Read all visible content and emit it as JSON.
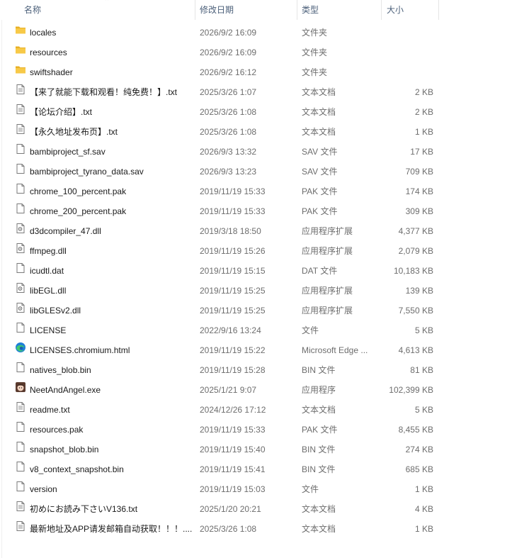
{
  "columns": {
    "name": "名称",
    "date": "修改日期",
    "type": "类型",
    "size": "大小"
  },
  "sort_indicator": "⌃",
  "files": [
    {
      "name": "locales",
      "date": "2026/9/2 16:09",
      "type": "文件夹",
      "size": "",
      "icon": "folder-icon"
    },
    {
      "name": "resources",
      "date": "2026/9/2 16:09",
      "type": "文件夹",
      "size": "",
      "icon": "folder-icon"
    },
    {
      "name": "swiftshader",
      "date": "2026/9/2 16:12",
      "type": "文件夹",
      "size": "",
      "icon": "folder-icon"
    },
    {
      "name": "【来了就能下载和观看！纯免费！】.txt",
      "date": "2025/3/26 1:07",
      "type": "文本文档",
      "size": "2 KB",
      "icon": "text-file-icon"
    },
    {
      "name": "【论坛介绍】.txt",
      "date": "2025/3/26 1:08",
      "type": "文本文档",
      "size": "2 KB",
      "icon": "text-file-icon"
    },
    {
      "name": "【永久地址发布页】.txt",
      "date": "2025/3/26 1:08",
      "type": "文本文档",
      "size": "1 KB",
      "icon": "text-file-icon"
    },
    {
      "name": "bambiproject_sf.sav",
      "date": "2026/9/3 13:32",
      "type": "SAV 文件",
      "size": "17 KB",
      "icon": "file-icon"
    },
    {
      "name": "bambiproject_tyrano_data.sav",
      "date": "2026/9/3 13:23",
      "type": "SAV 文件",
      "size": "709 KB",
      "icon": "file-icon"
    },
    {
      "name": "chrome_100_percent.pak",
      "date": "2019/11/19 15:33",
      "type": "PAK 文件",
      "size": "174 KB",
      "icon": "file-icon"
    },
    {
      "name": "chrome_200_percent.pak",
      "date": "2019/11/19 15:33",
      "type": "PAK 文件",
      "size": "309 KB",
      "icon": "file-icon"
    },
    {
      "name": "d3dcompiler_47.dll",
      "date": "2019/3/18 18:50",
      "type": "应用程序扩展",
      "size": "4,377 KB",
      "icon": "dll-file-icon"
    },
    {
      "name": "ffmpeg.dll",
      "date": "2019/11/19 15:26",
      "type": "应用程序扩展",
      "size": "2,079 KB",
      "icon": "dll-file-icon"
    },
    {
      "name": "icudtl.dat",
      "date": "2019/11/19 15:15",
      "type": "DAT 文件",
      "size": "10,183 KB",
      "icon": "file-icon"
    },
    {
      "name": "libEGL.dll",
      "date": "2019/11/19 15:25",
      "type": "应用程序扩展",
      "size": "139 KB",
      "icon": "dll-file-icon"
    },
    {
      "name": "libGLESv2.dll",
      "date": "2019/11/19 15:25",
      "type": "应用程序扩展",
      "size": "7,550 KB",
      "icon": "dll-file-icon"
    },
    {
      "name": "LICENSE",
      "date": "2022/9/16 13:24",
      "type": "文件",
      "size": "5 KB",
      "icon": "file-icon"
    },
    {
      "name": "LICENSES.chromium.html",
      "date": "2019/11/19 15:22",
      "type": "Microsoft Edge ...",
      "size": "4,613 KB",
      "icon": "edge-icon"
    },
    {
      "name": "natives_blob.bin",
      "date": "2019/11/19 15:28",
      "type": "BIN 文件",
      "size": "81 KB",
      "icon": "file-icon"
    },
    {
      "name": "NeetAndAngel.exe",
      "date": "2025/1/21 9:07",
      "type": "应用程序",
      "size": "102,399 KB",
      "icon": "app-character-icon"
    },
    {
      "name": "readme.txt",
      "date": "2024/12/26 17:12",
      "type": "文本文档",
      "size": "5 KB",
      "icon": "text-file-icon"
    },
    {
      "name": "resources.pak",
      "date": "2019/11/19 15:33",
      "type": "PAK 文件",
      "size": "8,455 KB",
      "icon": "file-icon"
    },
    {
      "name": "snapshot_blob.bin",
      "date": "2019/11/19 15:40",
      "type": "BIN 文件",
      "size": "274 KB",
      "icon": "file-icon"
    },
    {
      "name": "v8_context_snapshot.bin",
      "date": "2019/11/19 15:41",
      "type": "BIN 文件",
      "size": "685 KB",
      "icon": "file-icon"
    },
    {
      "name": "version",
      "date": "2019/11/19 15:03",
      "type": "文件",
      "size": "1 KB",
      "icon": "file-icon"
    },
    {
      "name": "初めにお読み下さいV136.txt",
      "date": "2025/1/20 20:21",
      "type": "文本文档",
      "size": "4 KB",
      "icon": "text-file-icon"
    },
    {
      "name": "最新地址及APP请发邮箱自动获取！！！....",
      "date": "2025/3/26 1:08",
      "type": "文本文档",
      "size": "1 KB",
      "icon": "text-file-icon"
    }
  ]
}
